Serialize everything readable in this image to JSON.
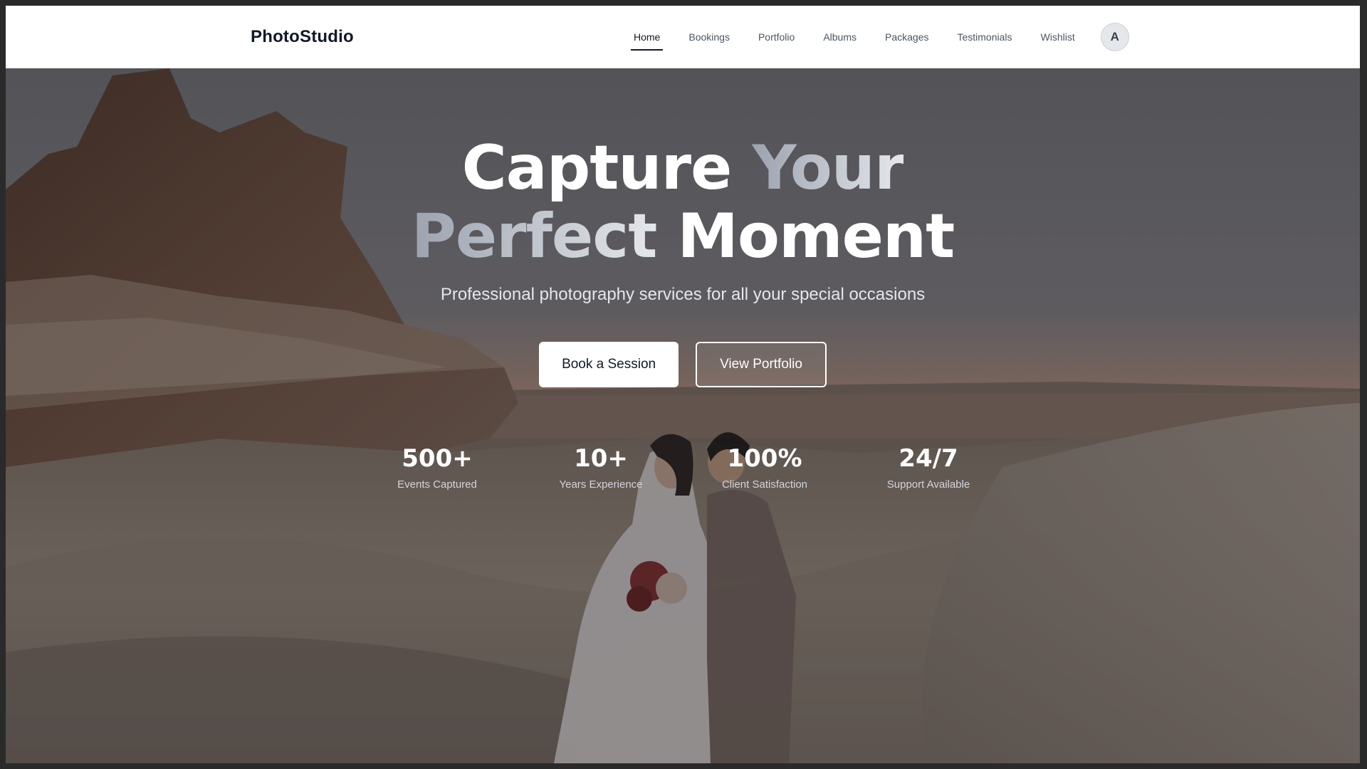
{
  "brand": {
    "name": "PhotoStudio"
  },
  "nav": {
    "items": [
      {
        "label": "Home",
        "active": true
      },
      {
        "label": "Bookings",
        "active": false
      },
      {
        "label": "Portfolio",
        "active": false
      },
      {
        "label": "Albums",
        "active": false
      },
      {
        "label": "Packages",
        "active": false
      },
      {
        "label": "Testimonials",
        "active": false
      },
      {
        "label": "Wishlist",
        "active": false
      }
    ],
    "avatar_initial": "A"
  },
  "hero": {
    "headline": {
      "line1_a": "Capture",
      "line1_b": "Your",
      "line2_a": "Perfect",
      "line2_b": "Moment"
    },
    "subtitle": "Professional photography services for all your special occasions",
    "primary_button": "Book a Session",
    "secondary_button": "View Portfolio",
    "stats": [
      {
        "value": "500+",
        "label": "Events Captured"
      },
      {
        "value": "10+",
        "label": "Years Experience"
      },
      {
        "value": "100%",
        "label": "Client Satisfaction"
      },
      {
        "value": "24/7",
        "label": "Support Available"
      }
    ]
  },
  "colors": {
    "text_dark": "#111827",
    "nav_text": "#4b5563",
    "accent_white": "#ffffff"
  }
}
